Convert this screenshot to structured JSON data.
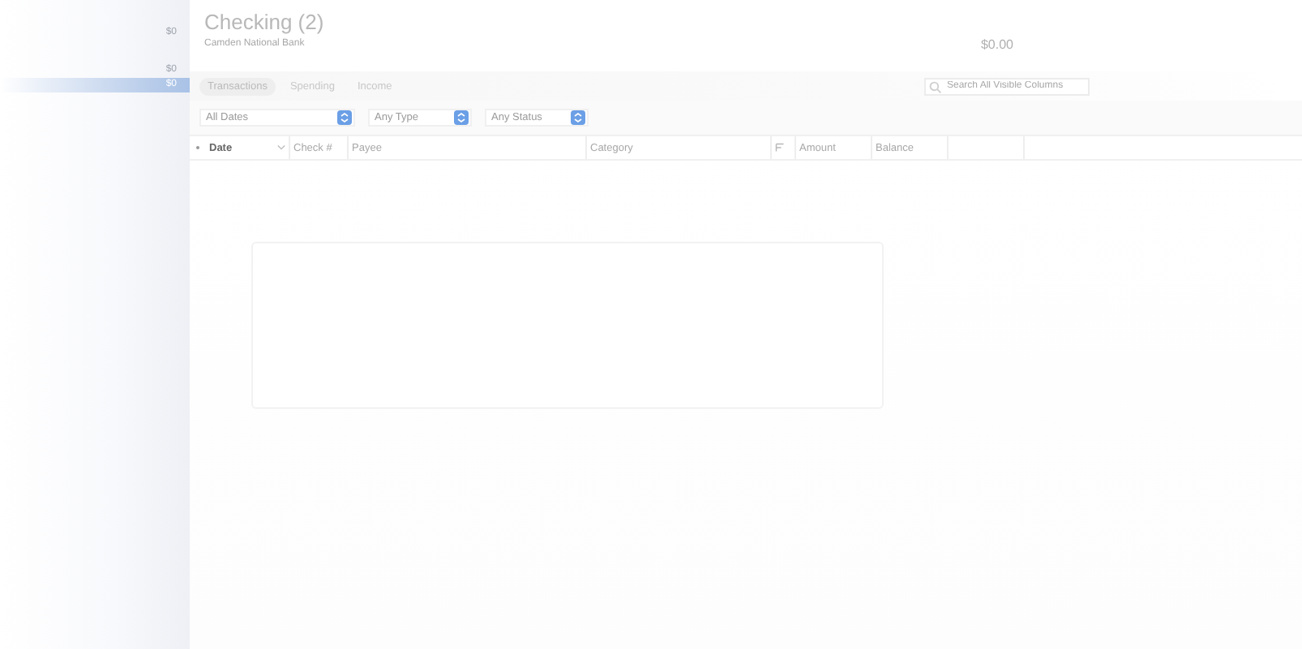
{
  "sidebar": {
    "items": [
      {
        "amount": "$0",
        "selected": false
      },
      {
        "amount": "$0",
        "selected": false
      },
      {
        "amount": "$0",
        "selected": true
      }
    ]
  },
  "header": {
    "title": "Checking (2)",
    "subtitle": "Camden National Bank",
    "balance": "$0.00"
  },
  "tabs": [
    {
      "label": "Transactions",
      "selected": true
    },
    {
      "label": "Spending",
      "selected": false
    },
    {
      "label": "Income",
      "selected": false
    }
  ],
  "search": {
    "placeholder": "Search All Visible Columns"
  },
  "filters": [
    {
      "value": "All Dates"
    },
    {
      "value": "Any Type"
    },
    {
      "value": "Any Status"
    }
  ],
  "table": {
    "columns": [
      {
        "label": "Date",
        "sorted": true
      },
      {
        "label": "Check #",
        "sorted": false
      },
      {
        "label": "Payee",
        "sorted": false
      },
      {
        "label": "Category",
        "sorted": false
      },
      {
        "kind": "icon"
      },
      {
        "label": "Amount",
        "sorted": false
      },
      {
        "label": "Balance",
        "sorted": false
      }
    ]
  }
}
